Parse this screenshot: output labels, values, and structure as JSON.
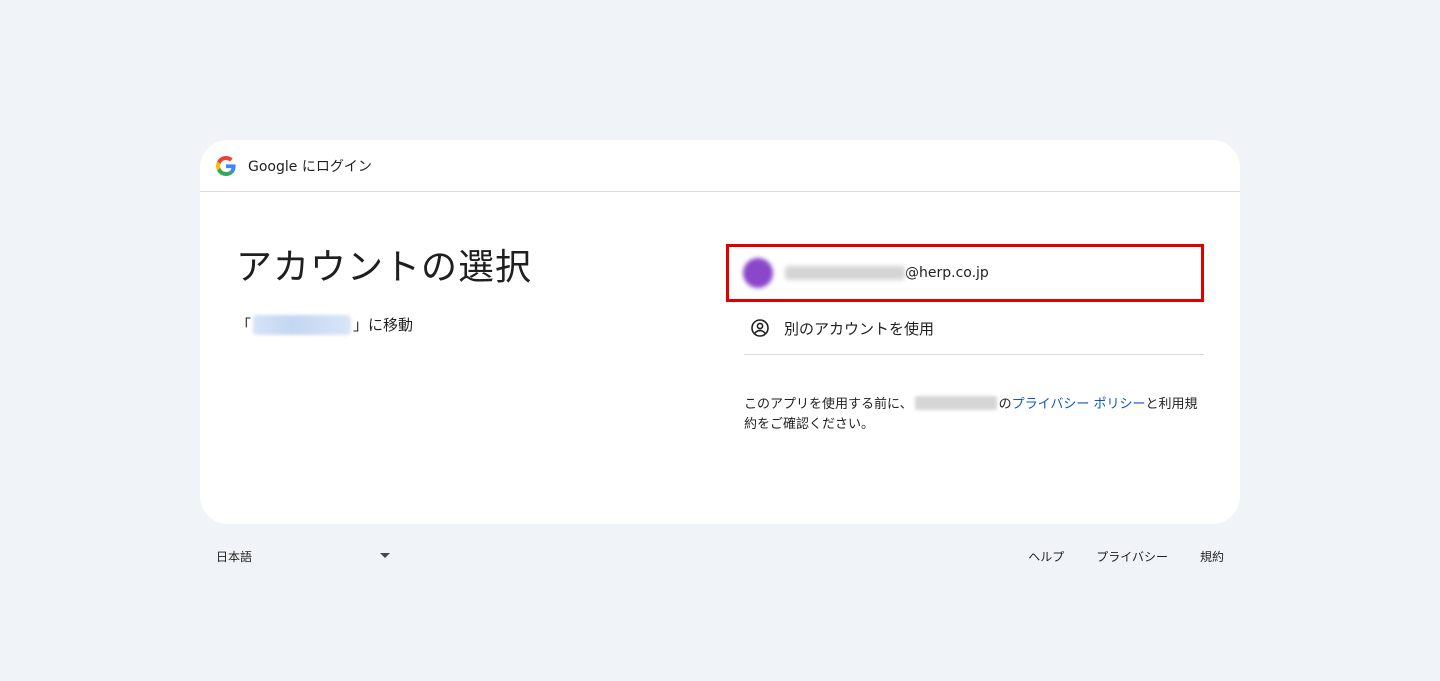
{
  "header": {
    "title": "Google にログイン",
    "logo_icon": "google-g-icon"
  },
  "main": {
    "title": "アカウントの選択",
    "continue_prefix": "「",
    "continue_suffix": "」に移動"
  },
  "accounts": [
    {
      "email_domain": "@herp.co.jp",
      "avatar_color": "#8a47c9"
    }
  ],
  "other_account": {
    "label": "別のアカウントを使用",
    "icon": "person-circle-icon"
  },
  "policy": {
    "before": "このアプリを使用する前に、",
    "of": "の",
    "privacy_link": "プライバシー ポリシー",
    "and_terms": "と利用規約をご確認ください。"
  },
  "footer": {
    "language": "日本語",
    "links": [
      "ヘルプ",
      "プライバシー",
      "規約"
    ]
  },
  "colors": {
    "background": "#f0f4f9",
    "link": "#0b57d0",
    "highlight_border": "#e00000"
  }
}
